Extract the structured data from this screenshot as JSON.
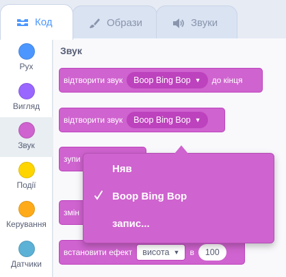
{
  "tabs": [
    {
      "label": "Код",
      "icon": "code-icon"
    },
    {
      "label": "Образи",
      "icon": "brush-icon"
    },
    {
      "label": "Звуки",
      "icon": "speaker-icon"
    }
  ],
  "categories": [
    {
      "label": "Рух",
      "color": "#4c97ff"
    },
    {
      "label": "Вигляд",
      "color": "#9966ff"
    },
    {
      "label": "Звук",
      "color": "#cf63cf"
    },
    {
      "label": "Події",
      "color": "#ffd500"
    },
    {
      "label": "Керування",
      "color": "#ffab19"
    },
    {
      "label": "Датчики",
      "color": "#5cb1d6"
    }
  ],
  "palette": {
    "section_title": "Звук",
    "block1": {
      "text_a": "відтворити звук",
      "sound": "Boop Bing Bop",
      "text_b": "до кінця"
    },
    "block2": {
      "text_a": "відтворити звук",
      "sound": "Boop Bing Bop"
    },
    "block3": {
      "text_a": "зупи"
    },
    "block4": {
      "text_a": "змін"
    },
    "block5": {
      "text_a": "встановити ефект",
      "effect": "висота",
      "text_b": "в",
      "value": "100"
    }
  },
  "dropdown": {
    "items": [
      {
        "label": "Няв",
        "checked": false
      },
      {
        "label": "Boop Bing Bop",
        "checked": true
      },
      {
        "label": "запис...",
        "checked": false
      }
    ]
  },
  "colors": {
    "accent": "#4c97ff",
    "sound": "#cf63cf",
    "sound_dark": "#bd42bd"
  }
}
